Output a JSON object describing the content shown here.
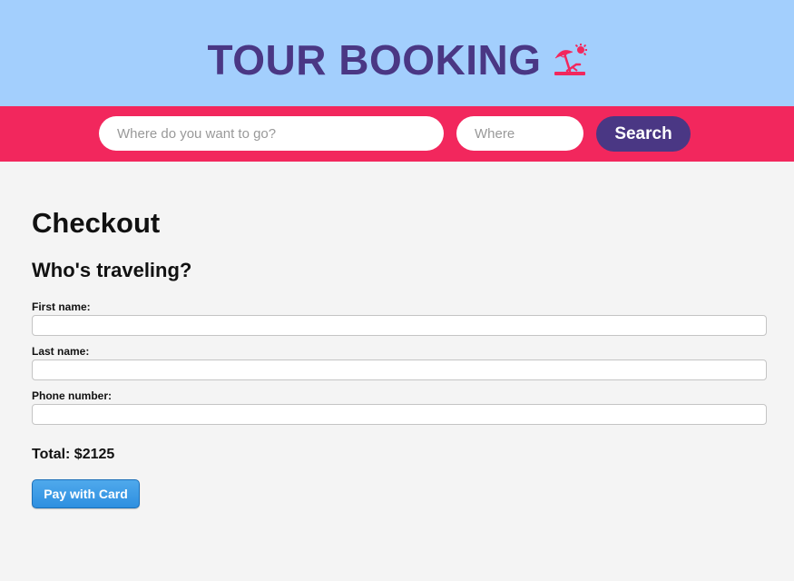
{
  "header": {
    "title": "TOUR BOOKING",
    "icon": "beach-umbrella-icon",
    "background_color": "#a3cffd",
    "title_color": "#4a3784"
  },
  "search": {
    "destination_placeholder": "Where do you want to go?",
    "destination_value": "",
    "where_placeholder": "Where",
    "where_value": "",
    "button_label": "Search",
    "bar_color": "#f2275d",
    "button_color": "#4a3784"
  },
  "checkout": {
    "title": "Checkout",
    "subtitle": "Who's traveling?",
    "fields": [
      {
        "label": "First name:",
        "value": ""
      },
      {
        "label": "Last name:",
        "value": ""
      },
      {
        "label": "Phone number:",
        "value": ""
      }
    ],
    "total": "Total: $2125",
    "pay_button_label": "Pay with Card"
  }
}
